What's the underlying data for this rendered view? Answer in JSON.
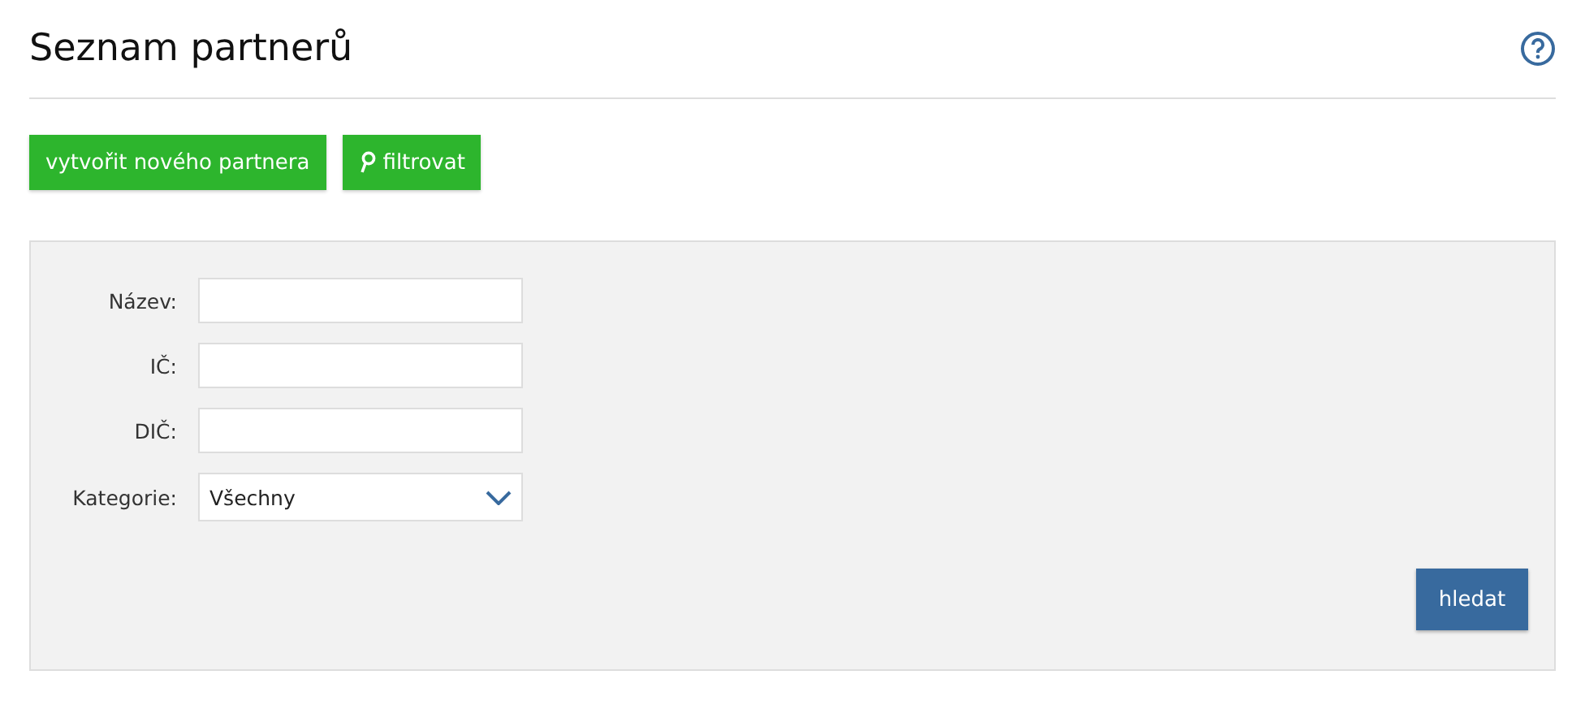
{
  "page": {
    "title": "Seznam partnerů"
  },
  "actions": [
    {
      "label": "vytvořit nového partnera",
      "kind": "plain"
    },
    {
      "label": "filtrovat",
      "kind": "search"
    }
  ],
  "filter": {
    "fields": [
      {
        "label": "Název:",
        "kind": "text"
      },
      {
        "label": "IČ:",
        "kind": "text"
      },
      {
        "label": "DIČ:",
        "kind": "text"
      },
      {
        "label": "Kategorie:",
        "kind": "select",
        "value": "Všechny"
      }
    ],
    "submit": "hledat"
  }
}
